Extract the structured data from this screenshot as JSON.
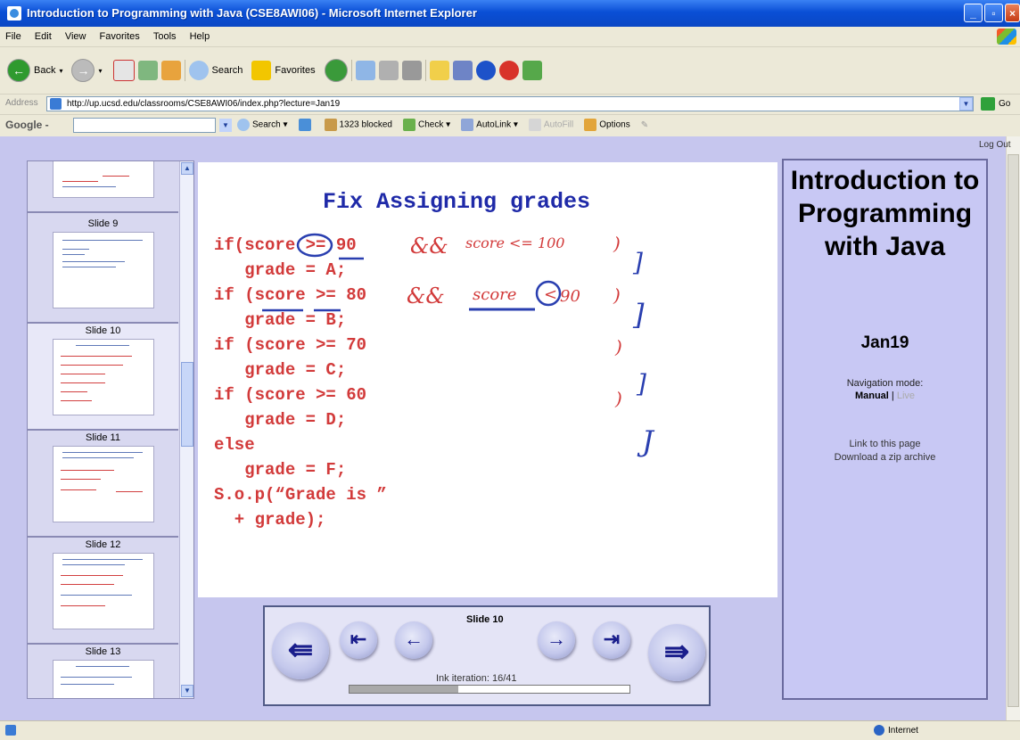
{
  "window": {
    "title": "Introduction to Programming with Java (CSE8AWI06) - Microsoft Internet Explorer"
  },
  "menu": [
    "File",
    "Edit",
    "View",
    "Favorites",
    "Tools",
    "Help"
  ],
  "toolbar": {
    "back_label": "Back",
    "search_label": "Search",
    "favorites_label": "Favorites"
  },
  "address": {
    "label": "Address",
    "url": "http://up.ucsd.edu/classrooms/CSE8AWI06/index.php?lecture=Jan19",
    "go_label": "Go"
  },
  "googlebar": {
    "logo": "Google -",
    "search_label": "Search",
    "blocked_label": "1323 blocked",
    "check_label": "Check",
    "autolink_label": "AutoLink",
    "autofill_label": "AutoFill",
    "options_label": "Options"
  },
  "page": {
    "logout_label": "Log Out"
  },
  "thumbnails": [
    {
      "label": ""
    },
    {
      "label": "Slide 9"
    },
    {
      "label": "Slide 10"
    },
    {
      "label": "Slide 11"
    },
    {
      "label": "Slide 12"
    },
    {
      "label": "Slide 13"
    }
  ],
  "slide": {
    "title": "Fix Assigning grades",
    "code_lines": [
      "if(score >= 90",
      "   grade = A;",
      "if (score >= 80",
      "   grade = B;",
      "if (score >= 70",
      "   grade = C;",
      "if (score >= 60",
      "   grade = D;",
      "else",
      "   grade = F;",
      "S.o.p(“Grade is ”",
      "  + grade);"
    ],
    "ink_texts": [
      "&&",
      "score <= 100",
      ")",
      "&&",
      "score",
      "<",
      "90",
      ")",
      ")",
      ")",
      "]",
      "]",
      "]",
      "J"
    ]
  },
  "navigation": {
    "slide_label": "Slide 10",
    "ink_iteration_label": "Ink iteration: 16/41",
    "ink_progress": 0.39
  },
  "info": {
    "title": "Introduction to Programming with Java",
    "lecture": "Jan19",
    "nav_mode_label": "Navigation mode:",
    "mode_manual": "Manual",
    "mode_separator": "|",
    "mode_live": "Live",
    "link_label": "Link to this page",
    "zip_label": "Download a zip archive"
  },
  "status": {
    "zone": "Internet"
  },
  "colors": {
    "code_red": "#d23a3a",
    "ink_blue": "#2a3fb0",
    "title_blue": "#1f2aa8",
    "page_bg": "#c6c6ee",
    "panel_bg": "#c8c8f4"
  }
}
